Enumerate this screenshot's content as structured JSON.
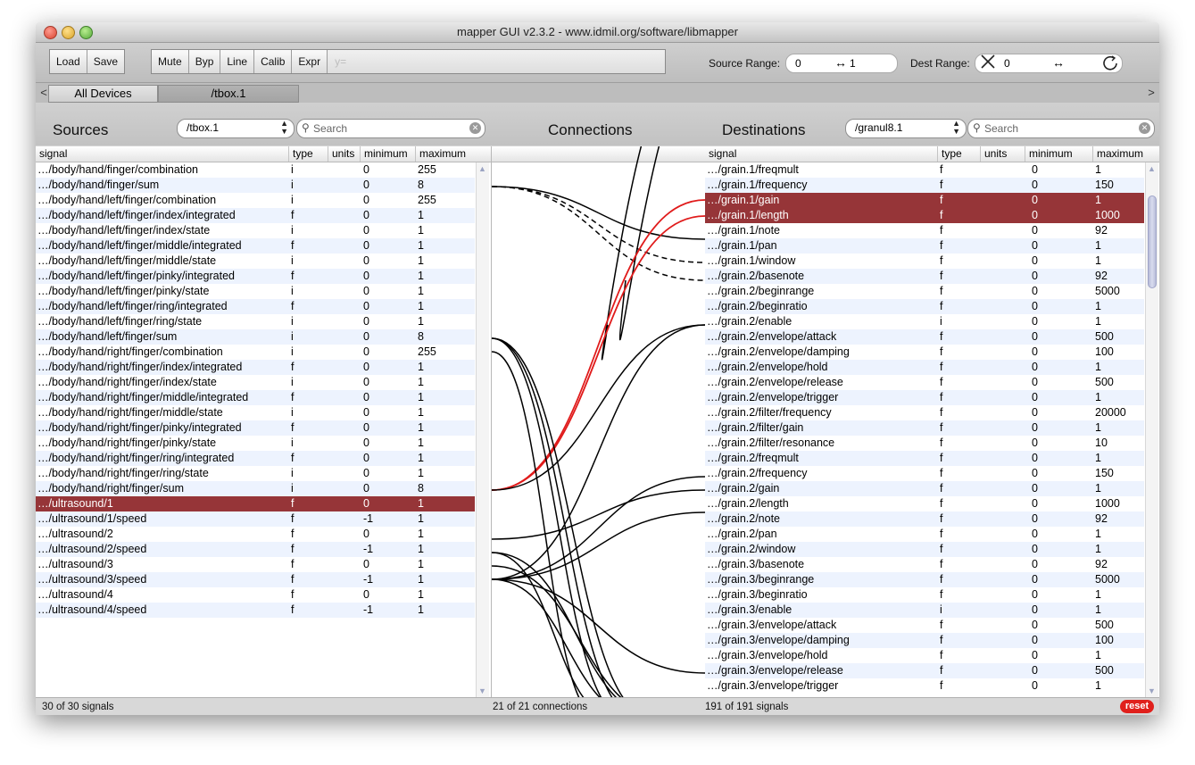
{
  "window": {
    "title": "mapper GUI v2.3.2 - www.idmil.org/software/libmapper"
  },
  "toolbar": {
    "buttons_left": [
      "Load",
      "Save"
    ],
    "buttons_right": [
      "Mute",
      "Byp",
      "Line",
      "Calib",
      "Expr"
    ],
    "expr_placeholder": "y=",
    "source_range_label": "Source Range:",
    "source_min": "0",
    "source_max": "1",
    "dest_range_label": "Dest Range:",
    "dest_min": "0",
    "dest_max": "",
    "swap_glyph": "↔"
  },
  "device_tabs": [
    {
      "label": "All Devices",
      "active": true
    },
    {
      "label": "/tbox.1",
      "active": false
    }
  ],
  "sources": {
    "title": "Sources",
    "device_select": "/tbox.1",
    "search_placeholder": "Search",
    "columns": [
      "signal",
      "type",
      "units",
      "minimum",
      "maximum"
    ],
    "selected_index": 22,
    "rows": [
      [
        "…/body/hand/finger/combination",
        "i",
        "",
        "0",
        "255"
      ],
      [
        "…/body/hand/finger/sum",
        "i",
        "",
        "0",
        "8"
      ],
      [
        "…/body/hand/left/finger/combination",
        "i",
        "",
        "0",
        "255"
      ],
      [
        "…/body/hand/left/finger/index/integrated",
        "f",
        "",
        "0",
        "1"
      ],
      [
        "…/body/hand/left/finger/index/state",
        "i",
        "",
        "0",
        "1"
      ],
      [
        "…/body/hand/left/finger/middle/integrated",
        "f",
        "",
        "0",
        "1"
      ],
      [
        "…/body/hand/left/finger/middle/state",
        "i",
        "",
        "0",
        "1"
      ],
      [
        "…/body/hand/left/finger/pinky/integrated",
        "f",
        "",
        "0",
        "1"
      ],
      [
        "…/body/hand/left/finger/pinky/state",
        "i",
        "",
        "0",
        "1"
      ],
      [
        "…/body/hand/left/finger/ring/integrated",
        "f",
        "",
        "0",
        "1"
      ],
      [
        "…/body/hand/left/finger/ring/state",
        "i",
        "",
        "0",
        "1"
      ],
      [
        "…/body/hand/left/finger/sum",
        "i",
        "",
        "0",
        "8"
      ],
      [
        "…/body/hand/right/finger/combination",
        "i",
        "",
        "0",
        "255"
      ],
      [
        "…/body/hand/right/finger/index/integrated",
        "f",
        "",
        "0",
        "1"
      ],
      [
        "…/body/hand/right/finger/index/state",
        "i",
        "",
        "0",
        "1"
      ],
      [
        "…/body/hand/right/finger/middle/integrated",
        "f",
        "",
        "0",
        "1"
      ],
      [
        "…/body/hand/right/finger/middle/state",
        "i",
        "",
        "0",
        "1"
      ],
      [
        "…/body/hand/right/finger/pinky/integrated",
        "f",
        "",
        "0",
        "1"
      ],
      [
        "…/body/hand/right/finger/pinky/state",
        "i",
        "",
        "0",
        "1"
      ],
      [
        "…/body/hand/right/finger/ring/integrated",
        "f",
        "",
        "0",
        "1"
      ],
      [
        "…/body/hand/right/finger/ring/state",
        "i",
        "",
        "0",
        "1"
      ],
      [
        "…/body/hand/right/finger/sum",
        "i",
        "",
        "0",
        "8"
      ],
      [
        "…/ultrasound/1",
        "f",
        "",
        "0",
        "1"
      ],
      [
        "…/ultrasound/1/speed",
        "f",
        "",
        "-1",
        "1"
      ],
      [
        "…/ultrasound/2",
        "f",
        "",
        "0",
        "1"
      ],
      [
        "…/ultrasound/2/speed",
        "f",
        "",
        "-1",
        "1"
      ],
      [
        "…/ultrasound/3",
        "f",
        "",
        "0",
        "1"
      ],
      [
        "…/ultrasound/3/speed",
        "f",
        "",
        "-1",
        "1"
      ],
      [
        "…/ultrasound/4",
        "f",
        "",
        "0",
        "1"
      ],
      [
        "…/ultrasound/4/speed",
        "f",
        "",
        "-1",
        "1"
      ]
    ],
    "status": "30 of 30 signals"
  },
  "connections": {
    "title": "Connections",
    "status": "21 of 21 connections"
  },
  "destinations": {
    "title": "Destinations",
    "device_select": "/granul8.1",
    "search_placeholder": "Search",
    "columns": [
      "signal",
      "type",
      "units",
      "minimum",
      "maximum"
    ],
    "selected_indices": [
      2,
      3
    ],
    "scroll_position": 0.05,
    "rows": [
      [
        "…/grain.1/freqmult",
        "f",
        "",
        "0",
        "1"
      ],
      [
        "…/grain.1/frequency",
        "f",
        "",
        "0",
        "150"
      ],
      [
        "…/grain.1/gain",
        "f",
        "",
        "0",
        "1"
      ],
      [
        "…/grain.1/length",
        "f",
        "",
        "0",
        "1000"
      ],
      [
        "…/grain.1/note",
        "f",
        "",
        "0",
        "92"
      ],
      [
        "…/grain.1/pan",
        "f",
        "",
        "0",
        "1"
      ],
      [
        "…/grain.1/window",
        "f",
        "",
        "0",
        "1"
      ],
      [
        "…/grain.2/basenote",
        "f",
        "",
        "0",
        "92"
      ],
      [
        "…/grain.2/beginrange",
        "f",
        "",
        "0",
        "5000"
      ],
      [
        "…/grain.2/beginratio",
        "f",
        "",
        "0",
        "1"
      ],
      [
        "…/grain.2/enable",
        "i",
        "",
        "0",
        "1"
      ],
      [
        "…/grain.2/envelope/attack",
        "f",
        "",
        "0",
        "500"
      ],
      [
        "…/grain.2/envelope/damping",
        "f",
        "",
        "0",
        "100"
      ],
      [
        "…/grain.2/envelope/hold",
        "f",
        "",
        "0",
        "1"
      ],
      [
        "…/grain.2/envelope/release",
        "f",
        "",
        "0",
        "500"
      ],
      [
        "…/grain.2/envelope/trigger",
        "f",
        "",
        "0",
        "1"
      ],
      [
        "…/grain.2/filter/frequency",
        "f",
        "",
        "0",
        "20000"
      ],
      [
        "…/grain.2/filter/gain",
        "f",
        "",
        "0",
        "1"
      ],
      [
        "…/grain.2/filter/resonance",
        "f",
        "",
        "0",
        "10"
      ],
      [
        "…/grain.2/freqmult",
        "f",
        "",
        "0",
        "1"
      ],
      [
        "…/grain.2/frequency",
        "f",
        "",
        "0",
        "150"
      ],
      [
        "…/grain.2/gain",
        "f",
        "",
        "0",
        "1"
      ],
      [
        "…/grain.2/length",
        "f",
        "",
        "0",
        "1000"
      ],
      [
        "…/grain.2/note",
        "f",
        "",
        "0",
        "92"
      ],
      [
        "…/grain.2/pan",
        "f",
        "",
        "0",
        "1"
      ],
      [
        "…/grain.2/window",
        "f",
        "",
        "0",
        "1"
      ],
      [
        "…/grain.3/basenote",
        "f",
        "",
        "0",
        "92"
      ],
      [
        "…/grain.3/beginrange",
        "f",
        "",
        "0",
        "5000"
      ],
      [
        "…/grain.3/beginratio",
        "f",
        "",
        "0",
        "1"
      ],
      [
        "…/grain.3/enable",
        "i",
        "",
        "0",
        "1"
      ],
      [
        "…/grain.3/envelope/attack",
        "f",
        "",
        "0",
        "500"
      ],
      [
        "…/grain.3/envelope/damping",
        "f",
        "",
        "0",
        "100"
      ],
      [
        "…/grain.3/envelope/hold",
        "f",
        "",
        "0",
        "1"
      ],
      [
        "…/grain.3/envelope/release",
        "f",
        "",
        "0",
        "500"
      ],
      [
        "…/grain.3/envelope/trigger",
        "f",
        "",
        "0",
        "1"
      ]
    ],
    "status": "191 of 191 signals"
  },
  "reset_label": "reset",
  "colors": {
    "selection": "#963538",
    "alt_row": "#edf3fe",
    "reset": "#e0201c",
    "selected_connection": "#e01b1b"
  }
}
